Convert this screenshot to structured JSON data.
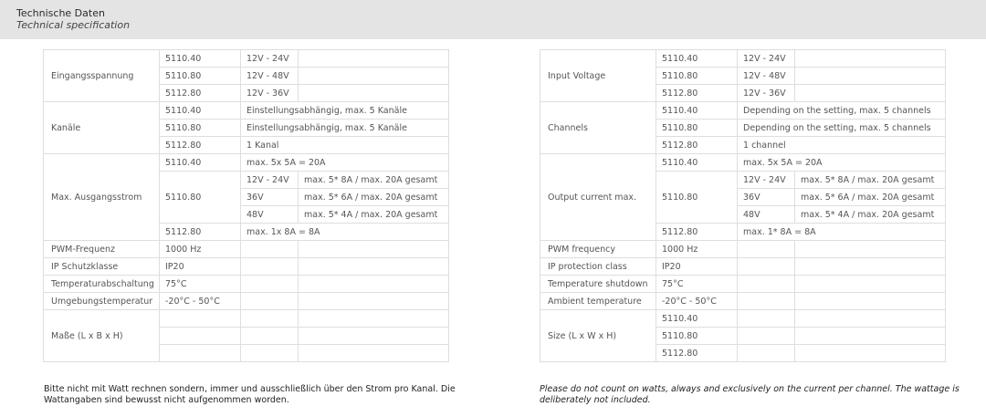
{
  "header": {
    "title": "Technische Daten",
    "subtitle": "Technical specification"
  },
  "de": {
    "input_voltage_label": "Eingangsspannung",
    "channels_label": "Kanäle",
    "output_label": "Max. Ausgangsstrom",
    "pwm_label": "PWM-Frequenz",
    "pwm_value": "1000 Hz",
    "ip_label": "IP Schutzklasse",
    "ip_value": "IP20",
    "temp_label": "Temperaturabschaltung",
    "temp_value": "75°C",
    "ambient_label": "Umgebungstemperatur",
    "ambient_value": "-20°C - 50°C",
    "size_label": "Maße (L x B x H)",
    "ch_5110_40": "Einstellungsabhängig, max. 5 Kanäle",
    "ch_5110_80": "Einstellungsabhängig, max. 5 Kanäle",
    "ch_5112_80": "1 Kanal",
    "out_5110_40": "max. 5x 5A = 20A",
    "out_5112_80": "max. 1x 8A = 8A",
    "note": "Bitte nicht mit Watt rechnen sondern, immer und ausschließlich über den Strom pro Kanal. Die Wattangaben sind bewusst nicht aufgenommen worden."
  },
  "en": {
    "input_voltage_label": "Input Voltage",
    "channels_label": "Channels",
    "output_label": "Output current max.",
    "pwm_label": "PWM frequency",
    "pwm_value": "1000 Hz",
    "ip_label": "IP protection class",
    "ip_value": "IP20",
    "temp_label": "Temperature shutdown",
    "temp_value": "75°C",
    "ambient_label": "Ambient temperature",
    "ambient_value": "-20°C - 50°C",
    "size_label": "Size (L x W x H)",
    "ch_5110_40": "Depending on the setting, max. 5 channels",
    "ch_5110_80": "Depending on the setting, max. 5 channels",
    "ch_5112_80": "1 channel",
    "out_5110_40": "max. 5x 5A = 20A",
    "out_5112_80": "max. 1* 8A = 8A",
    "note": "Please do not count on watts, always and exclusively on the current per channel. The wattage is deliberately not included."
  },
  "models": {
    "m1": "5110.40",
    "m2": "5110.80",
    "m3": "5112.80"
  },
  "voltages": {
    "m1": "12V - 24V",
    "m2": "12V - 48V",
    "m3": "12V - 36V"
  },
  "output_5110_80": {
    "v1": "12V - 24V",
    "c1": "max. 5* 8A / max. 20A gesamt",
    "v2": "36V",
    "c2": "max. 5* 6A / max. 20A gesamt",
    "v3": "48V",
    "c3": "max. 5* 4A / max. 20A gesamt"
  }
}
